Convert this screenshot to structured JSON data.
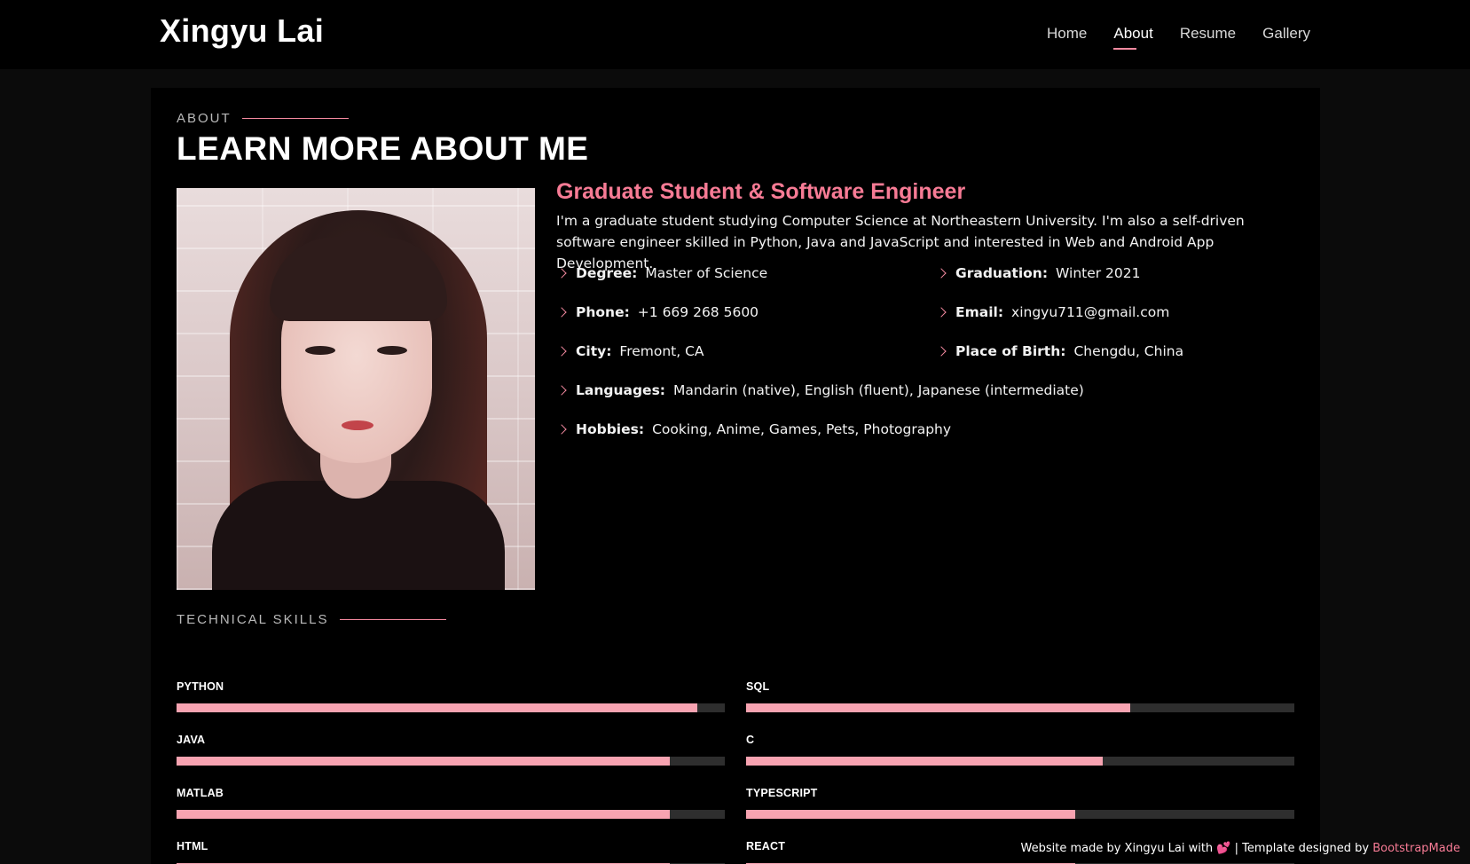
{
  "header": {
    "logo": "Xingyu Lai",
    "nav": [
      {
        "label": "Home",
        "active": false
      },
      {
        "label": "About",
        "active": true
      },
      {
        "label": "Resume",
        "active": false
      },
      {
        "label": "Gallery",
        "active": false
      }
    ]
  },
  "about": {
    "subtitle": "ABOUT",
    "title": "LEARN MORE ABOUT ME",
    "heading": "Graduate Student & Software Engineer",
    "description": "I'm a graduate student studying Computer Science at Northeastern University. I'm also a self-driven software engineer skilled in Python, Java and JavaScript and interested in Web and Android App Development.",
    "facts": [
      {
        "key": "Degree:",
        "value": "Master of Science"
      },
      {
        "key": "Graduation:",
        "value": "Winter 2021"
      },
      {
        "key": "Phone:",
        "value": "+1 669 268 5600"
      },
      {
        "key": "Email:",
        "value": "xingyu711@gmail.com"
      },
      {
        "key": "City:",
        "value": "Fremont, CA"
      },
      {
        "key": "Place of Birth:",
        "value": "Chengdu, China"
      },
      {
        "key": "Languages:",
        "value": "Mandarin (native), English (fluent), Japanese (intermediate)"
      },
      {
        "key": "Hobbies:",
        "value": "Cooking, Anime, Games, Pets, Photography"
      }
    ]
  },
  "skills": {
    "subtitle": "TECHNICAL SKILLS",
    "items": [
      {
        "name": "PYTHON",
        "level": 0.95
      },
      {
        "name": "SQL",
        "level": 0.7
      },
      {
        "name": "JAVA",
        "level": 0.9
      },
      {
        "name": "C",
        "level": 0.65
      },
      {
        "name": "MATLAB",
        "level": 0.9
      },
      {
        "name": "TYPESCRIPT",
        "level": 0.6
      },
      {
        "name": "HTML",
        "level": 0.9
      },
      {
        "name": "REACT",
        "level": 0.6
      }
    ]
  },
  "footer": {
    "text_before": "Website made by Xingyu Lai with",
    "heart": "💕",
    "text_middle": "| Template designed by",
    "link": "BootstrapMade"
  },
  "colors": {
    "accent": "#f77b95",
    "bar_fill": "#f7a3b1",
    "bar_track": "#2e2e2e"
  }
}
